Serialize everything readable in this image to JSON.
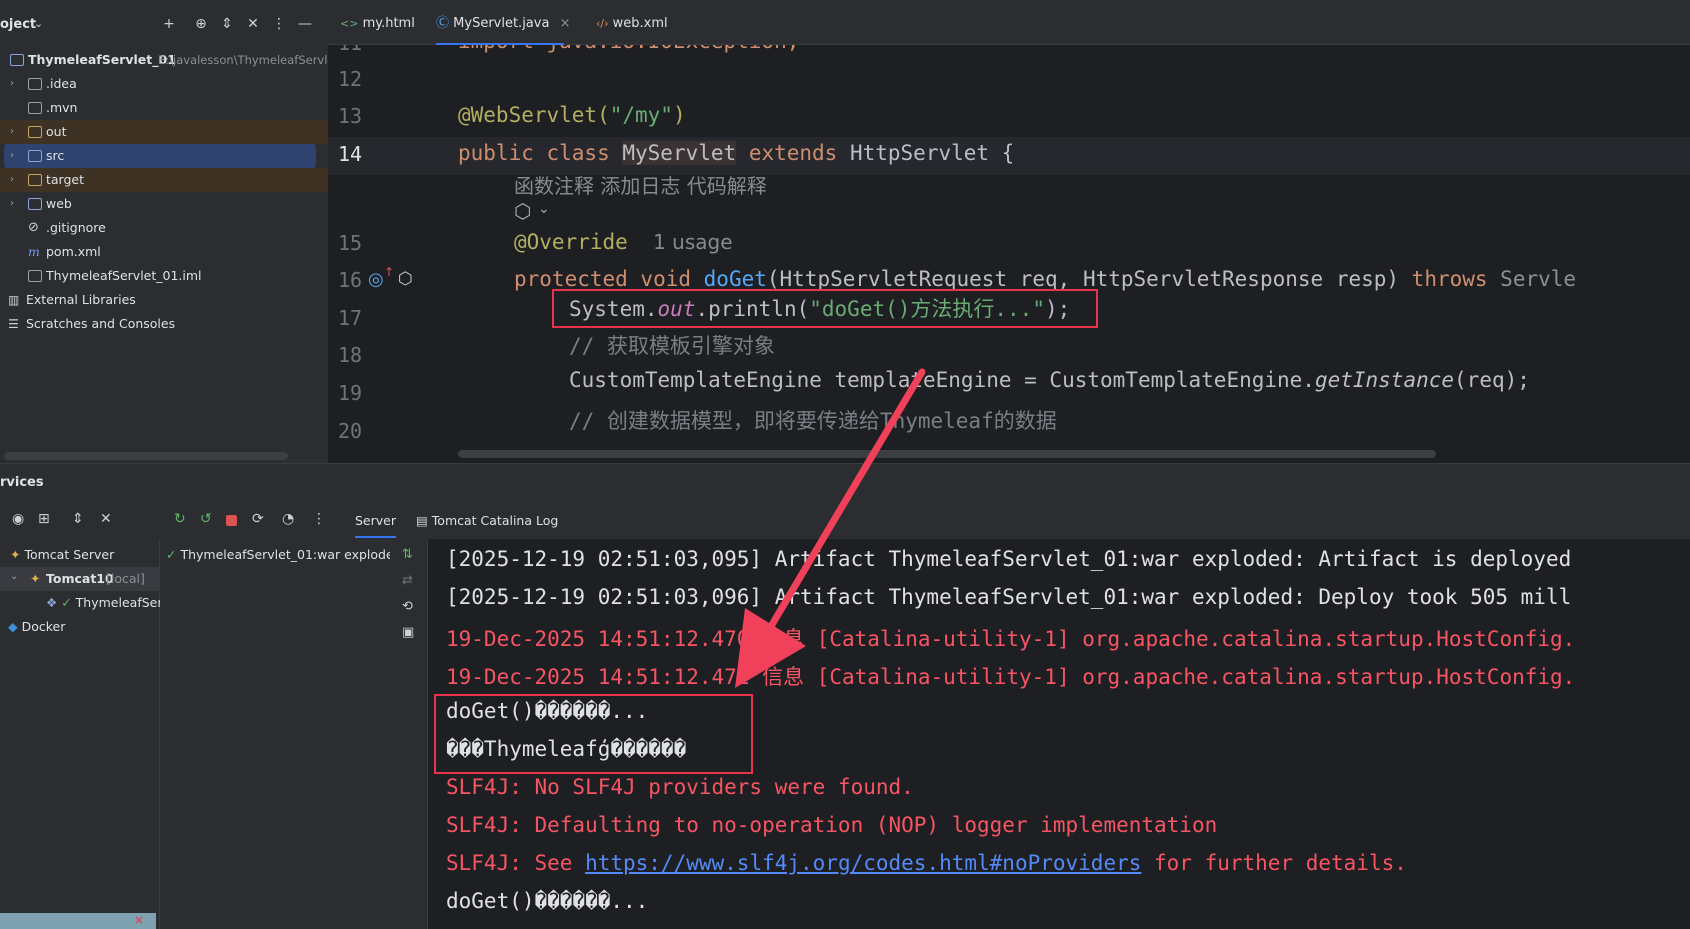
{
  "project": {
    "title": "oject",
    "root_name": "ThymeleafServlet_01",
    "root_path": "E:\\javalesson\\ThymeleafServle",
    "items": [
      {
        "label": ".idea"
      },
      {
        "label": ".mvn"
      },
      {
        "label": "out"
      },
      {
        "label": "src"
      },
      {
        "label": "target"
      },
      {
        "label": "web"
      },
      {
        "label": ".gitignore"
      },
      {
        "label": "pom.xml"
      },
      {
        "label": "ThymeleafServlet_01.iml"
      }
    ],
    "external_libraries": "External Libraries",
    "scratches": "Scratches and Consoles"
  },
  "tabs": [
    {
      "label": "my.html"
    },
    {
      "label": "MyServlet.java"
    },
    {
      "label": "web.xml"
    }
  ],
  "editor": {
    "line_numbers": [
      "11",
      "12",
      "13",
      "14",
      "15",
      "16",
      "17",
      "18",
      "19",
      "20"
    ],
    "line11": "import java.io.IOException;",
    "line13_ann": "@WebServlet(",
    "line13_str": "\"/my\"",
    "line13_end": ")",
    "line14_kw": "public class ",
    "line14_cls": "MyServlet",
    "line14_ext": " extends ",
    "line14_rest": "HttpServlet {",
    "ai_hints": "函数注释 添加日志 代码解释",
    "line15_ann": "@Override",
    "line15_usage": "1 usage",
    "line16_kw": "protected void ",
    "line16_fn": "doGet",
    "line16_params": "(HttpServletRequest req, HttpServletResponse resp) ",
    "line16_throws": "throws",
    "line16_exc": " Servle",
    "line17_a": "System.",
    "line17_b": "out",
    "line17_c": ".println(",
    "line17_str": "\"doGet()方法执行...\"",
    "line17_d": ");",
    "line18": "// 获取模板引擎对象",
    "line19_a": "CustomTemplateEngine templateEngine = CustomTemplateEngine.",
    "line19_b": "getInstance",
    "line19_c": "(req);",
    "line20": "// 创建数据模型，即将要传递给Thymeleaf的数据"
  },
  "services": {
    "title": "rvices",
    "tabs": [
      {
        "label": "Server"
      },
      {
        "label": "Tomcat Catalina Log"
      }
    ],
    "tree": {
      "tomcat_server": "Tomcat Server",
      "tomcat10": "Tomcat10",
      "local": "[local]",
      "deployment": "ThymeleafSer",
      "docker": "Docker"
    },
    "artifact": "ThymeleafServlet_01:war exploded"
  },
  "console": {
    "lines": [
      {
        "text": "[2025-12-19 02:51:03,095] Artifact ThymeleafServlet_01:war exploded: Artifact is deployed"
      },
      {
        "text": "[2025-12-19 02:51:03,096] Artifact ThymeleafServlet_01:war exploded: Deploy took 505 mill"
      },
      {
        "text": "19-Dec-2025 14:51:12.470 信息 [Catalina-utility-1] org.apache.catalina.startup.HostConfig."
      },
      {
        "text": "19-Dec-2025 14:51:12.471 信息 [Catalina-utility-1] org.apache.catalina.startup.HostConfig."
      },
      {
        "text": "doGet()������..."
      },
      {
        "text": "���Thymeleafģ������"
      },
      {
        "text": "SLF4J: No SLF4J providers were found."
      },
      {
        "text": "SLF4J: Defaulting to no-operation (NOP) logger implementation"
      },
      {
        "text": "SLF4J: See "
      },
      {
        "text": "doGet()������..."
      }
    ],
    "link": "https://www.slf4j.org/codes.html#noProviders",
    "link_tail": " for further details."
  },
  "colors": {
    "accent": "#3574f0",
    "annotation_red": "#e8334a",
    "console_error": "#f75464"
  }
}
